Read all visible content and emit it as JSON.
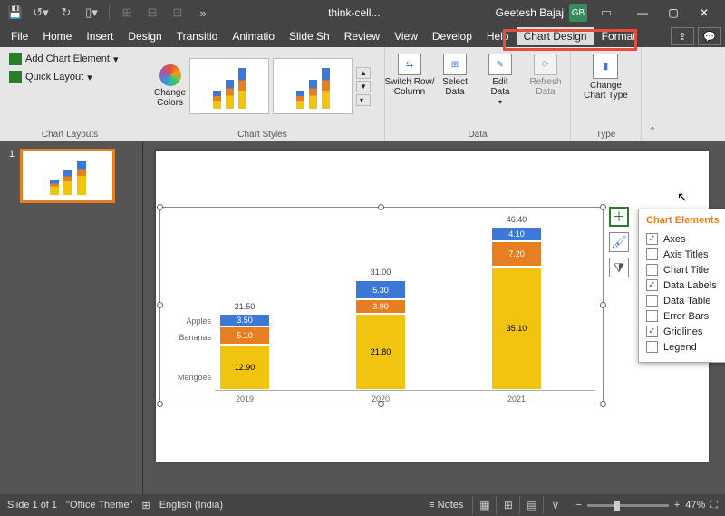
{
  "titlebar": {
    "doc": "think-cell...",
    "user": "Geetesh Bajaj",
    "initials": "GB"
  },
  "menubar": {
    "items": [
      "File",
      "Home",
      "Insert",
      "Design",
      "Transitio",
      "Animatio",
      "Slide Sh",
      "Review",
      "View",
      "Develop",
      "Help",
      "Chart Design",
      "Format"
    ],
    "active": "Chart Design"
  },
  "ribbon": {
    "layouts": {
      "add": "Add Chart Element",
      "quick": "Quick Layout",
      "group": "Chart Layouts"
    },
    "styles": {
      "colors": "Change\nColors",
      "group": "Chart Styles"
    },
    "data": {
      "switch": "Switch Row/\nColumn",
      "select": "Select\nData",
      "edit": "Edit\nData",
      "refresh": "Refresh\nData",
      "group": "Data"
    },
    "type": {
      "change": "Change\nChart Type",
      "group": "Type"
    }
  },
  "thumbs": {
    "n1": "1"
  },
  "chart_data": {
    "type": "bar",
    "categories": [
      "2019",
      "2020",
      "2021"
    ],
    "series": [
      {
        "name": "Mangoes",
        "values": [
          12.9,
          21.8,
          35.1
        ]
      },
      {
        "name": "Bananas",
        "values": [
          5.1,
          3.9,
          7.2
        ]
      },
      {
        "name": "Apples",
        "values": [
          3.5,
          5.3,
          4.1
        ]
      }
    ],
    "totals": [
      21.5,
      31.0,
      46.4
    ],
    "segment_labels": {
      "2019": {
        "Mangoes": "12.90",
        "Bananas": "5.10",
        "Apples": "3.50"
      },
      "2020": {
        "Mangoes": "21.80",
        "Bananas": "3.90",
        "Apples": "5.30"
      },
      "2021": {
        "Mangoes": "35.10",
        "Bananas": "7.20",
        "Apples": "4.10"
      }
    },
    "total_labels": {
      "2019": "21.50",
      "2020": "31.00",
      "2021": "46.40"
    },
    "xlabels": {
      "x0": "2019",
      "x1": "2020",
      "x2": "2021"
    },
    "row_labels": {
      "apples": "Apples",
      "bananas": "Bananas",
      "mangoes": "Mangoes"
    }
  },
  "chart_elements": {
    "title": "Chart Elements",
    "items": [
      {
        "label": "Axes",
        "checked": true
      },
      {
        "label": "Axis Titles",
        "checked": false
      },
      {
        "label": "Chart Title",
        "checked": false
      },
      {
        "label": "Data Labels",
        "checked": true
      },
      {
        "label": "Data Table",
        "checked": false
      },
      {
        "label": "Error Bars",
        "checked": false
      },
      {
        "label": "Gridlines",
        "checked": true
      },
      {
        "label": "Legend",
        "checked": false
      }
    ]
  },
  "statusbar": {
    "slide": "Slide 1 of 1",
    "theme": "\"Office Theme\"",
    "lang": "English (India)",
    "notes": "Notes",
    "zoom": "47%"
  }
}
